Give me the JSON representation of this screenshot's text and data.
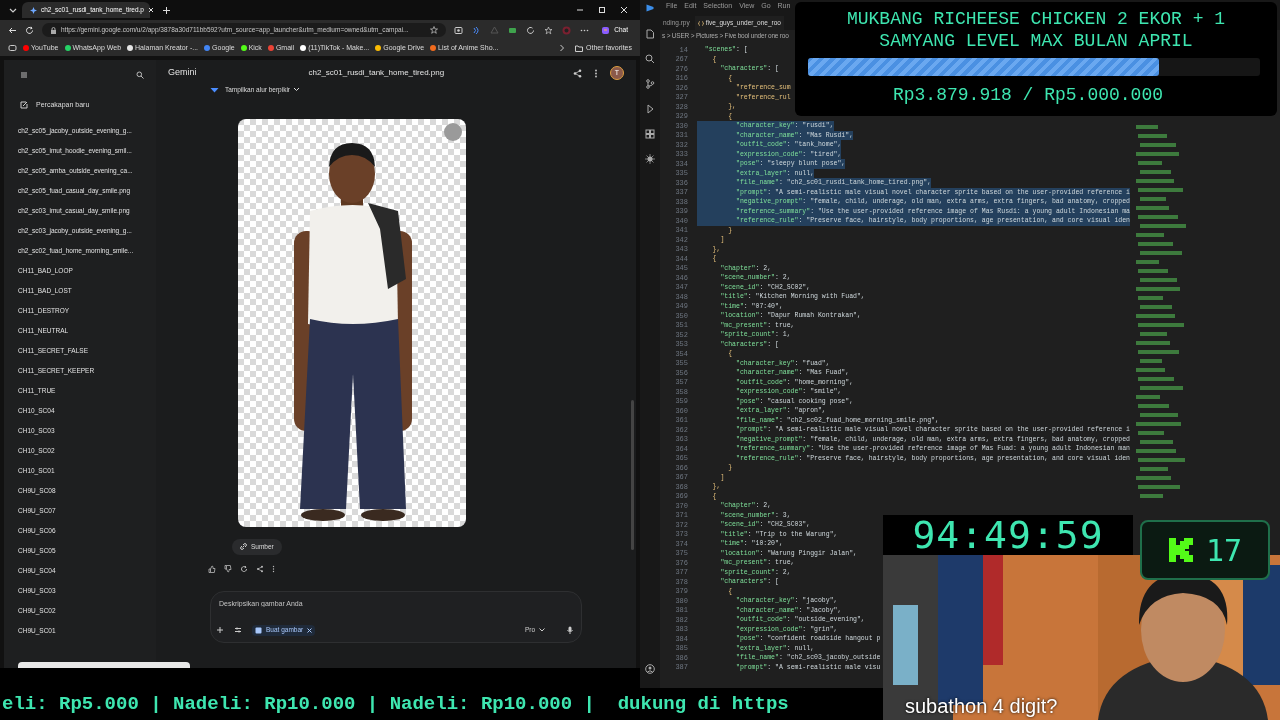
{
  "browser": {
    "tab": {
      "title": "ch2_sc01_rusdi_tank_home_tired.p",
      "selected": true
    },
    "address": "https://gemini.google.com/u/2/app/3878a30d711bb592?utm_source=app_launcher&utm_medium=owned&utm_campai...",
    "chat_button": "Chat",
    "bookmarks": [
      {
        "label": "YouTube",
        "color": "#ff0000"
      },
      {
        "label": "WhatsApp Web",
        "color": "#25d366"
      },
      {
        "label": "Halaman Kreator -...",
        "color": "#e5e5e5"
      },
      {
        "label": "Google",
        "color": "#4285f4"
      },
      {
        "label": "Kick",
        "color": "#53fc18"
      },
      {
        "label": "Gmail",
        "color": "#ea4335"
      },
      {
        "label": "(11)TikTok - Make...",
        "color": "#ffffff"
      },
      {
        "label": "Google Drive",
        "color": "#fbbc04"
      },
      {
        "label": "List of Anime Sho...",
        "color": "#f26b1d"
      }
    ],
    "other_favorites": "Other favorites"
  },
  "gemini": {
    "app_name": "Gemini",
    "new_chat": "Percakapan baru",
    "chats": [
      "ch2_sc05_jacoby_outside_evening_g...",
      "ch2_sc05_imut_hoodie_evening_smil...",
      "ch2_sc05_amba_outside_evening_ca...",
      "ch2_sc05_fuad_casual_day_smile.png",
      "ch2_sc03_imut_casual_day_smile.png",
      "ch2_sc03_jacoby_outside_evening_g...",
      "ch2_sc02_fuad_home_morning_smile...",
      "CH11_BAD_LOOP",
      "CH11_BAD_LOST",
      "CH11_DESTROY",
      "CH11_NEUTRAL",
      "CH11_SECRET_FALSE",
      "CH11_SECRET_KEEPER",
      "CH11_TRUE",
      "CH10_SC04",
      "CH10_SC03",
      "CH10_SC02",
      "CH10_SC01",
      "CH9U_SC08",
      "CH9U_SC07",
      "CH9U_SC06",
      "CH9U_SC05",
      "CH9U_SC04",
      "CH9U_SC03",
      "CH9U_SC02",
      "CH9U_SC01"
    ],
    "file_title": "ch2_sc01_rusdi_tank_home_tired.png",
    "avatar": "T",
    "thinking_toggle": "Tampilkan alur berpikir",
    "source_button": "Sumber",
    "input": {
      "placeholder": "Deskripsikan gambar Anda"
    },
    "tool_chip": "Buat gambar",
    "model": "Pro"
  },
  "editor": {
    "menu": [
      "File",
      "Edit",
      "Selection",
      "View",
      "Go",
      "Run"
    ],
    "tabs": [
      {
        "label": "nding.rpy",
        "selected": false
      },
      {
        "label": "five_guys_under_one_roo",
        "selected": true
      }
    ],
    "breadcrumb": "s > USER > Pictures > Five bool under one roo",
    "lines": [
      {
        "number": "14",
        "text": "  \"scenes\": [",
        "selected": false
      },
      {
        "number": "267",
        "text": "    {",
        "selected": false
      },
      {
        "number": "276",
        "text": "      \"characters\": [",
        "selected": false
      },
      {
        "number": "316",
        "text": "        {",
        "selected": false
      },
      {
        "number": "326",
        "text": "          \"reference_sum",
        "selected": false
      },
      {
        "number": "327",
        "text": "          \"reference_rul",
        "selected": false
      },
      {
        "number": "328",
        "text": "        },",
        "selected": false
      },
      {
        "number": "329",
        "text": "        {",
        "selected": false
      },
      {
        "number": "330",
        "text": "          \"character_key\": \"rusdi\",",
        "selected": true
      },
      {
        "number": "331",
        "text": "          \"character_name\": \"Mas Rusdi\",",
        "selected": true
      },
      {
        "number": "332",
        "text": "          \"outfit_code\": \"tank_home\",",
        "selected": true
      },
      {
        "number": "333",
        "text": "          \"expression_code\": \"tired\",",
        "selected": true
      },
      {
        "number": "334",
        "text": "          \"pose\": \"sleepy blunt pose\",",
        "selected": true
      },
      {
        "number": "335",
        "text": "          \"extra_layer\": null,",
        "selected": true
      },
      {
        "number": "336",
        "text": "          \"file_name\": \"ch2_sc01_rusdi_tank_home_tired.png\",",
        "selected": true
      },
      {
        "number": "337",
        "text": "          \"prompt\": \"A semi-realistic male visual novel character sprite based on the user-provided reference i",
        "selected": true
      },
      {
        "number": "338",
        "text": "          \"negative_prompt\": \"female, child, underage, old man, extra arms, extra fingers, bad anatomy, cropped",
        "selected": true
      },
      {
        "number": "339",
        "text": "          \"reference_summary\": \"Use the user-provided reference image of Mas Rusdi: a young adult Indonesian ma",
        "selected": true
      },
      {
        "number": "340",
        "text": "          \"reference_rule\": \"Preserve face, hairstyle, body proportions, age presentation, and core visual iden",
        "selected": true
      },
      {
        "number": "341",
        "text": "        }",
        "selected": false
      },
      {
        "number": "342",
        "text": "      ]",
        "selected": false
      },
      {
        "number": "343",
        "text": "    },",
        "selected": false
      },
      {
        "number": "344",
        "text": "    {",
        "selected": false
      },
      {
        "number": "345",
        "text": "      \"chapter\": 2,",
        "selected": false
      },
      {
        "number": "346",
        "text": "      \"scene_number\": 2,",
        "selected": false
      },
      {
        "number": "347",
        "text": "      \"scene_id\": \"CH2_SC02\",",
        "selected": false
      },
      {
        "number": "348",
        "text": "      \"title\": \"Kitchen Morning with Fuad\",",
        "selected": false
      },
      {
        "number": "349",
        "text": "      \"time\": \"07:40\",",
        "selected": false
      },
      {
        "number": "350",
        "text": "      \"location\": \"Dapur Rumah Kontrakan\",",
        "selected": false
      },
      {
        "number": "351",
        "text": "      \"mc_present\": true,",
        "selected": false
      },
      {
        "number": "352",
        "text": "      \"sprite_count\": 1,",
        "selected": false
      },
      {
        "number": "353",
        "text": "      \"characters\": [",
        "selected": false
      },
      {
        "number": "354",
        "text": "        {",
        "selected": false
      },
      {
        "number": "355",
        "text": "          \"character_key\": \"fuad\",",
        "selected": false
      },
      {
        "number": "356",
        "text": "          \"character_name\": \"Mas Fuad\",",
        "selected": false
      },
      {
        "number": "357",
        "text": "          \"outfit_code\": \"home_morning\",",
        "selected": false
      },
      {
        "number": "358",
        "text": "          \"expression_code\": \"smile\",",
        "selected": false
      },
      {
        "number": "359",
        "text": "          \"pose\": \"casual cooking pose\",",
        "selected": false
      },
      {
        "number": "360",
        "text": "          \"extra_layer\": \"apron\",",
        "selected": false
      },
      {
        "number": "361",
        "text": "          \"file_name\": \"ch2_sc02_fuad_home_morning_smile.png\",",
        "selected": false
      },
      {
        "number": "362",
        "text": "          \"prompt\": \"A semi-realistic male visual novel character sprite based on the user-provided reference i",
        "selected": false
      },
      {
        "number": "363",
        "text": "          \"negative_prompt\": \"female, child, underage, old man, extra arms, extra fingers, bad anatomy, cropped",
        "selected": false
      },
      {
        "number": "364",
        "text": "          \"reference_summary\": \"Use the user-provided reference image of Mas Fuad: a young adult Indonesian man",
        "selected": false
      },
      {
        "number": "365",
        "text": "          \"reference_rule\": \"Preserve face, hairstyle, body proportions, age presentation, and core visual iden",
        "selected": false
      },
      {
        "number": "366",
        "text": "        }",
        "selected": false
      },
      {
        "number": "367",
        "text": "      ]",
        "selected": false
      },
      {
        "number": "368",
        "text": "    },",
        "selected": false
      },
      {
        "number": "369",
        "text": "    {",
        "selected": false
      },
      {
        "number": "370",
        "text": "      \"chapter\": 2,",
        "selected": false
      },
      {
        "number": "371",
        "text": "      \"scene_number\": 3,",
        "selected": false
      },
      {
        "number": "372",
        "text": "      \"scene_id\": \"CH2_SC03\",",
        "selected": false
      },
      {
        "number": "373",
        "text": "      \"title\": \"Trip to the Warung\",",
        "selected": false
      },
      {
        "number": "374",
        "text": "      \"time\": \"10:20\",",
        "selected": false
      },
      {
        "number": "375",
        "text": "      \"location\": \"Warung Pinggir Jalan\",",
        "selected": false
      },
      {
        "number": "376",
        "text": "      \"mc_present\": true,",
        "selected": false
      },
      {
        "number": "377",
        "text": "      \"sprite_count\": 2,",
        "selected": false
      },
      {
        "number": "378",
        "text": "      \"characters\": [",
        "selected": false
      },
      {
        "number": "379",
        "text": "        {",
        "selected": false
      },
      {
        "number": "380",
        "text": "          \"character_key\": \"jacoby\",",
        "selected": false
      },
      {
        "number": "381",
        "text": "          \"character_name\": \"Jacoby\",",
        "selected": false
      },
      {
        "number": "382",
        "text": "          \"outfit_code\": \"outside_evening\",",
        "selected": false
      },
      {
        "number": "383",
        "text": "          \"expression_code\": \"grin\",",
        "selected": false
      },
      {
        "number": "384",
        "text": "          \"pose\": \"confident roadside hangout p",
        "selected": false
      },
      {
        "number": "385",
        "text": "          \"extra_layer\": null,",
        "selected": false
      },
      {
        "number": "386",
        "text": "          \"file_name\": \"ch2_sc03_jacoby_outside",
        "selected": false
      },
      {
        "number": "387",
        "text": "          \"prompt\": \"A semi-realistic male visu",
        "selected": false
      }
    ]
  },
  "goal": {
    "title": "MUKBANG RICHEESE CHICKEN 2 EKOR + 1 SAMYANG LEVEL MAX BULAN APRIL",
    "level": 0.776,
    "amount": "Rp3.879.918 / Rp5.000.000"
  },
  "timer": "94:49:59",
  "kick": {
    "count": "17"
  },
  "webcam": {
    "caption": "subathon 4 digit?"
  },
  "ticker": "eli: Rp5.000 | Nadeli: Rp10.000 | Nadeli: Rp10.000 |  dukung di https"
}
